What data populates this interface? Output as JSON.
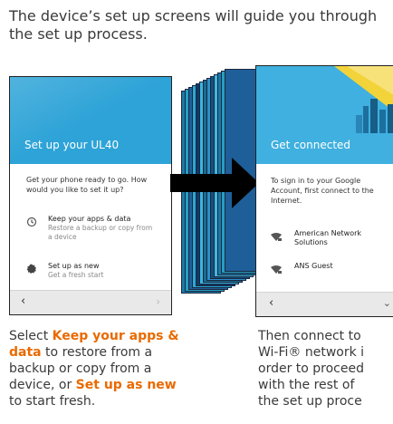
{
  "intro": "The device’s set up screens will guide you through the set up process.",
  "left_screen": {
    "title": "Set up your UL40",
    "prompt": "Get your phone ready to go. How would you like to set it up?",
    "options": [
      {
        "title": "Keep your apps & data",
        "subtitle": "Restore a backup or copy from a device",
        "icon": "restore-icon"
      },
      {
        "title": "Set up as new",
        "subtitle": "Get a fresh start",
        "icon": "new-device-icon"
      }
    ],
    "back": "‹",
    "forward": "›"
  },
  "right_screen": {
    "title": "Get connected",
    "prompt": "To sign in to your Google Account, first connect to the Internet.",
    "networks": [
      {
        "name": "American Network Solutions",
        "icon": "wifi-lock-icon"
      },
      {
        "name": "ANS Guest",
        "icon": "wifi-lock-icon"
      }
    ],
    "back": "‹",
    "chevron": "⌄"
  },
  "captions": {
    "left": {
      "pre": "Select ",
      "bold1": "Keep your apps & data",
      "mid": " to restore from a backup or copy from a device, or ",
      "bold2": "Set up as new",
      "post": " to start fresh."
    },
    "right": {
      "l1": "Then connect to",
      "l2": "Wi-Fi® network i",
      "l3": "order to proceed",
      "l4": "with the rest of",
      "l5": "the set up proce"
    }
  },
  "colors": {
    "header_blue": "#2da3d7",
    "stack_colors": [
      "#1b7aa6",
      "#27a0c0",
      "#1f5f99",
      "#2aa8d4",
      "#0f3a66",
      "#3bb6e0",
      "#1c6b8f",
      "#2b8fc9",
      "#16507a",
      "#41b7df",
      "#1b7aa6",
      "#27a0c0",
      "#1f5f99"
    ],
    "highlight": "#e96a00"
  }
}
